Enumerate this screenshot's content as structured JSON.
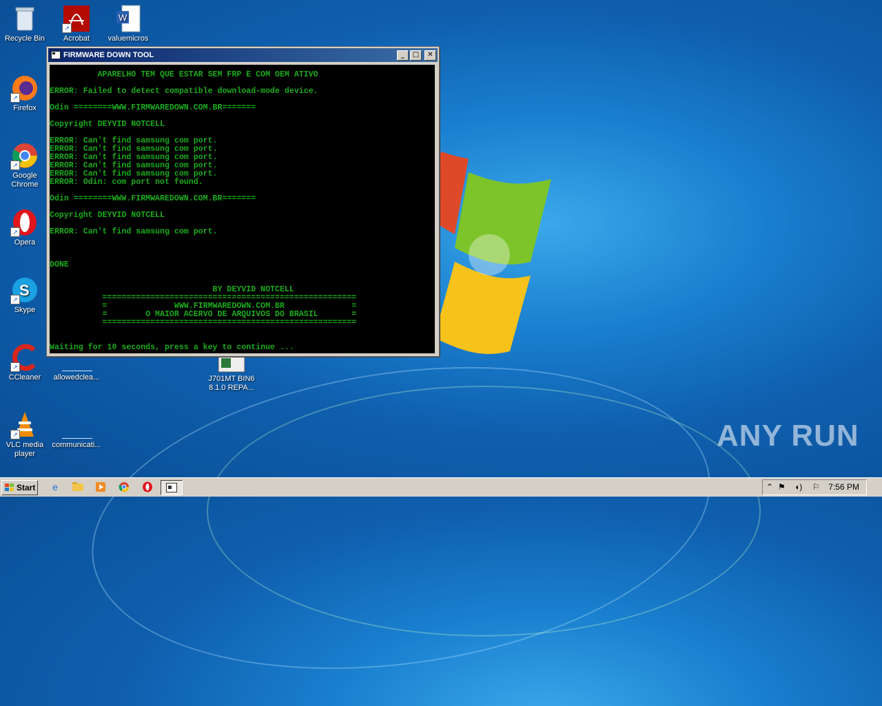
{
  "desktop": {
    "icons": [
      {
        "name": "Recycle Bin",
        "label": "Recycle Bin"
      },
      {
        "name": "Acrobat",
        "label": "Acrobat"
      },
      {
        "name": "valuemicros",
        "label": "valuemicros"
      },
      {
        "name": "Firefox",
        "label": "Firefox"
      },
      {
        "name": "Google Chrome",
        "label": "Google Chrome"
      },
      {
        "name": "Opera",
        "label": "Opera"
      },
      {
        "name": "Skype",
        "label": "Skype"
      },
      {
        "name": "CCleaner",
        "label": "CCleaner"
      },
      {
        "name": "allowedclea",
        "label": "allowedclea..."
      },
      {
        "name": "J701MT",
        "label": "J701MT BIN6 8.1.0 REPA..."
      },
      {
        "name": "VLC media player",
        "label": "VLC media player"
      },
      {
        "name": "communicati",
        "label": "communicati..."
      }
    ],
    "watermark": "ANY  RUN"
  },
  "window": {
    "title": "FIRMWARE DOWN TOOL",
    "buttons": {
      "minimize": "_",
      "maximize": "□",
      "close": "✕"
    },
    "lines": [
      "          APARELHO TEM QUE ESTAR SEM FRP E COM OEM ATIVO",
      "ERROR: Failed to detect compatible download-mode device.",
      "Odin ========WWW.FIRMWAREDOWN.COM.BR=======",
      "Copyright DEYVID NOTCELL",
      "ERROR: Can't find samsung com port.",
      "ERROR: Can't find samsung com port.",
      "ERROR: Can't find samsung com port.",
      "ERROR: Can't find samsung com port.",
      "ERROR: Can't find samsung com port.",
      "ERROR: Odin: com port not found.",
      "Odin ========WWW.FIRMWAREDOWN.COM.BR=======",
      "Copyright DEYVID NOTCELL",
      "ERROR: Can't find samsung com port.",
      "DONE",
      "                                  BY DEYVID NOTCELL",
      "           =====================================================",
      "           =              WWW.FIRMWAREDOWN.COM.BR              =",
      "           =        O MAIOR ACERVO DE ARQUIVOS DO BRASIL       =",
      "           =====================================================",
      "Waiting for 10 seconds, press a key to continue ..."
    ]
  },
  "taskbar": {
    "start_label": "Start",
    "clock": "7:56 PM"
  },
  "colors": {
    "console_text": "#1bab1b",
    "console_bg": "#000000",
    "title_gradient_start": "#0a246a"
  }
}
